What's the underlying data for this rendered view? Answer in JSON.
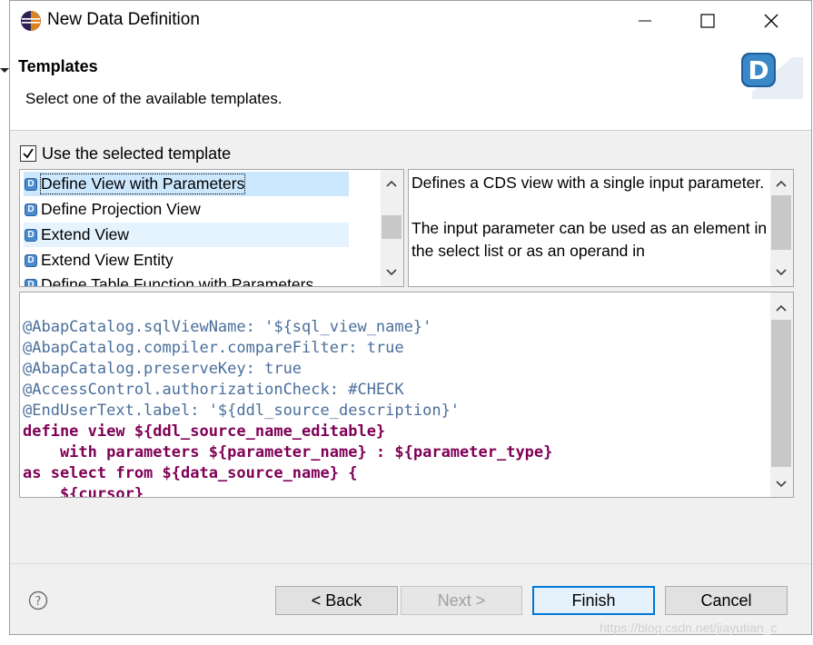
{
  "window": {
    "title": "New Data Definition",
    "controls": {
      "minimize": "minimize-icon",
      "maximize": "maximize-icon",
      "close": "close-icon"
    }
  },
  "header": {
    "title": "Templates",
    "description": "Select one of the available templates.",
    "logo_letter": "D"
  },
  "use_template": {
    "label": "Use the selected template",
    "checked": true
  },
  "templates": {
    "items": [
      {
        "label": "Define View with Parameters",
        "selected": true
      },
      {
        "label": "Define Projection View",
        "selected": false
      },
      {
        "label": "Extend View",
        "selected": false
      },
      {
        "label": "Extend View Entity",
        "selected": false
      },
      {
        "label": "Define Table Function with Parameters",
        "selected": false
      }
    ]
  },
  "description": {
    "text": "Defines a CDS view with a single input parameter.\n\nThe input parameter can be used as an element in the select list or as an operand in"
  },
  "code": {
    "lines": [
      "@AbapCatalog.sqlViewName: '${sql_view_name}'",
      "@AbapCatalog.compiler.compareFilter: true",
      "@AbapCatalog.preserveKey: true",
      "@AccessControl.authorizationCheck: #CHECK",
      "@EndUserText.label: '${ddl_source_description}'",
      "define view ${ddl_source_name_editable}",
      "    with parameters ${parameter_name} : ${parameter_type}",
      "as select from ${data_source_name} {",
      "    ${cursor}",
      "}"
    ]
  },
  "footer": {
    "help_icon": "help-icon",
    "back": "< Back",
    "next": "Next >",
    "finish": "Finish",
    "cancel": "Cancel"
  },
  "watermark": "https://blog.csdn.net/jiayutian_c",
  "colors": {
    "selection": "#cce8ff",
    "annotation": "#4a6f9b",
    "keyword": "#7f0055",
    "default_button_border": "#0078d7"
  }
}
